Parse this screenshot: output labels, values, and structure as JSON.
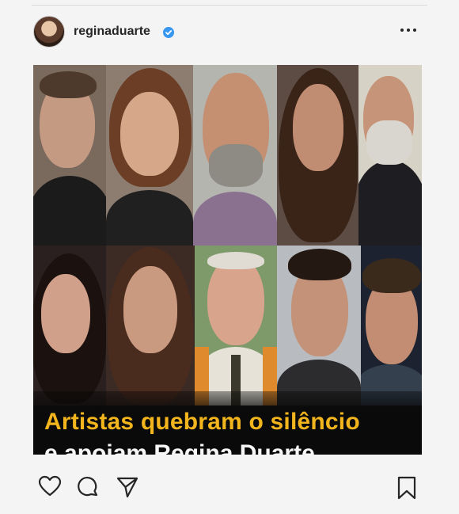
{
  "post": {
    "username": "reginaduarte",
    "caption_line1": "Artistas quebram o silêncio",
    "caption_line2": "e apoiam Regina Duarte"
  },
  "icons": {
    "verified": "verified-badge-icon",
    "more": "more-options-icon",
    "like": "heart-icon",
    "comment": "comment-icon",
    "share": "share-icon",
    "save": "bookmark-icon"
  },
  "colors": {
    "caption_accent": "#f2b51d",
    "verified": "#3897f0",
    "text": "#262626"
  }
}
